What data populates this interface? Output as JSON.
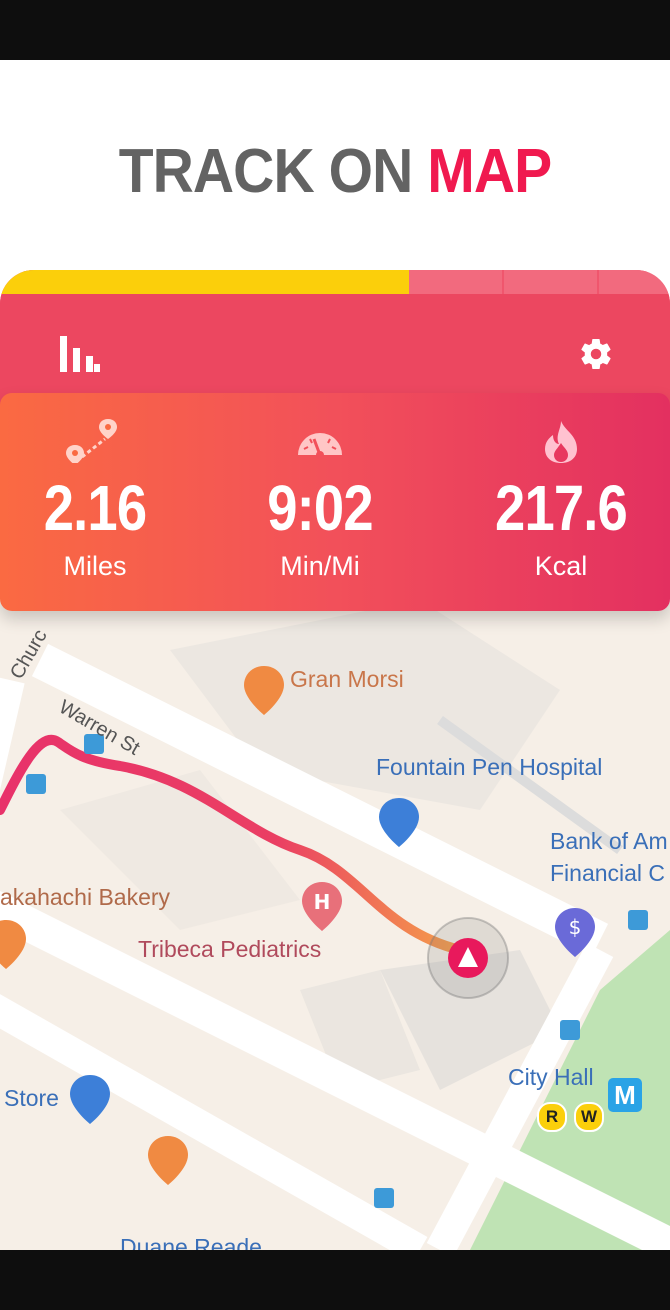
{
  "headline": {
    "word1": "TRACK ON",
    "word2": "MAP"
  },
  "tracker": {
    "progress_fraction": 0.61,
    "stats": [
      {
        "icon": "route-pin-icon",
        "value": "2.16",
        "unit": "Miles"
      },
      {
        "icon": "speedometer-icon",
        "value": "9:02",
        "unit": "Min/Mi"
      },
      {
        "icon": "flame-icon",
        "value": "217.6",
        "unit": "Kcal"
      }
    ]
  },
  "map": {
    "streets": {
      "church": "Churc",
      "warren": "Warren St"
    },
    "pois": {
      "gran_morsi": "Gran Morsi",
      "fountain_pen": "Fountain Pen Hospital",
      "bank_line1": "Bank of Am",
      "bank_line2": "Financial C",
      "bakery": "akahachi Bakery",
      "pediatrics": "Tribeca Pediatrics",
      "store": "Store",
      "city_hall": "City Hall",
      "duane_reade": "Duane Reade"
    },
    "subway": {
      "line1": "R",
      "line2": "W",
      "metro": "M"
    }
  },
  "colors": {
    "accent": "#f0194f",
    "headline_gray": "#636363",
    "progress_yellow": "#fbcf0b",
    "route_pink": "#e8326a",
    "route_orange": "#f5a04a",
    "card_orange": "#fa6a42",
    "card_red": "#e33060"
  }
}
